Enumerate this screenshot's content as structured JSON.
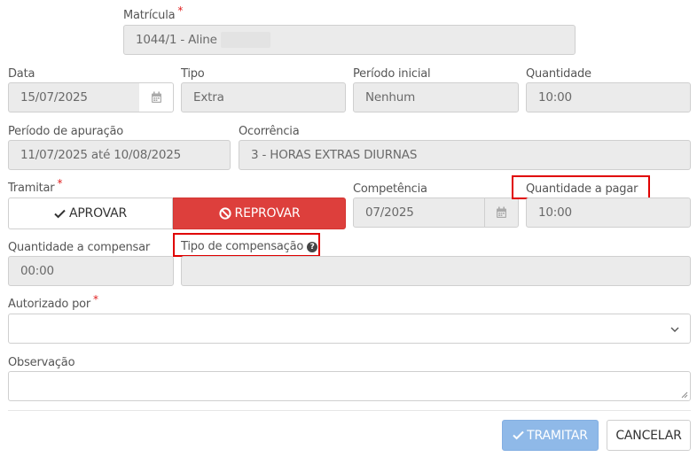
{
  "matricula": {
    "label": "Matrícula",
    "value": "1044/1 - Aline"
  },
  "data": {
    "label": "Data",
    "value": "15/07/2025"
  },
  "tipo": {
    "label": "Tipo",
    "value": "Extra"
  },
  "periodo_inicial": {
    "label": "Período inicial",
    "value": "Nenhum"
  },
  "quantidade": {
    "label": "Quantidade",
    "value": "10:00"
  },
  "periodo_apuracao": {
    "label": "Período de apuração",
    "value": "11/07/2025 até 10/08/2025"
  },
  "ocorrencia": {
    "label": "Ocorrência",
    "value": "3 - HORAS EXTRAS DIURNAS"
  },
  "tramitar": {
    "label": "Tramitar",
    "aprovar_label": "APROVAR",
    "reprovar_label": "REPROVAR"
  },
  "competencia": {
    "label": "Competência",
    "value": "07/2025"
  },
  "quantidade_pagar": {
    "label": "Quantidade a pagar",
    "value": "10:00"
  },
  "quantidade_compensar": {
    "label": "Quantidade a compensar",
    "value": "00:00"
  },
  "tipo_compensacao": {
    "label": "Tipo de compensação",
    "value": ""
  },
  "autorizado_por": {
    "label": "Autorizado por",
    "value": ""
  },
  "observacao": {
    "label": "Observação",
    "value": ""
  },
  "footer": {
    "tramitar_label": "TRAMITAR",
    "cancelar_label": "CANCELAR"
  },
  "required_marker": "*",
  "help_glyph": "?",
  "colors": {
    "reprovar_bg": "#dd3f3c",
    "tramitar_bg": "#8fb9e8",
    "highlight_box": "#e00000",
    "required": "#e02020",
    "field_bg": "#ebebeb"
  },
  "icons": [
    "calendar-icon",
    "check-icon",
    "ban-icon",
    "help-icon",
    "chevron-down-icon",
    "resize-grip-icon"
  ]
}
